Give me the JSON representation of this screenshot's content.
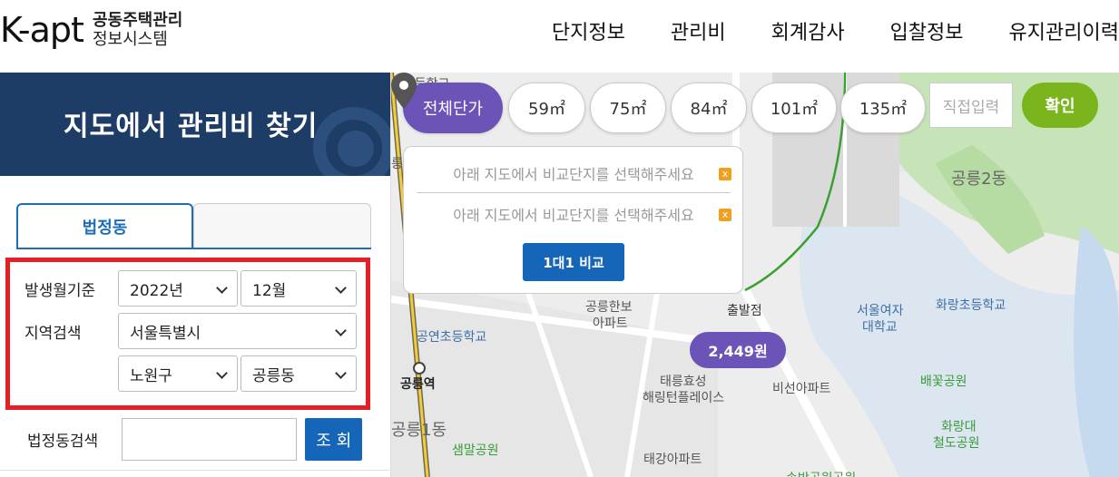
{
  "header": {
    "logo_text": "K-apt",
    "logo_sub_line1": "공동주택관리",
    "logo_sub_line2": "정보시스템",
    "nav": [
      "단지정보",
      "관리비",
      "회계감사",
      "입찰정보",
      "유지관리이력"
    ]
  },
  "sidebar": {
    "title": "지도에서 관리비 찾기",
    "tabs": {
      "active": "법정동",
      "inactive": ""
    },
    "filters": {
      "date_label": "발생월기준",
      "year": "2022년",
      "month": "12월",
      "region_label": "지역검색",
      "city": "서울특별시",
      "district": "노원구",
      "dong": "공릉동"
    },
    "legal_search_label": "법정동검색",
    "legal_search_button": "조 회"
  },
  "map": {
    "area_pills": [
      "전체단가",
      "59㎡",
      "75㎡",
      "84㎡",
      "101㎡",
      "135㎡"
    ],
    "direct_input_placeholder": "직접입력",
    "confirm_button": "확인",
    "compare": {
      "slot1": "아래 지도에서 비교단지를 선택해주세요",
      "slot2": "아래 지도에서 비교단지를 선택해주세요",
      "close": "x",
      "button": "1대1 비교"
    },
    "price_bubble": "2,449원",
    "labels": {
      "top_school": "촌초등학교",
      "left_edge": "릉",
      "gongneung2": "공릉2동",
      "gongneung_hanbo1": "공릉한보",
      "gongneung_hanbo2": "아파트",
      "chulbaljeom": "출발점",
      "seoul_womens1": "서울여자",
      "seoul_womens2": "대학교",
      "hwarang_elem": "화랑초등학교",
      "gongyeon_elem": "공연초등학교",
      "gongneung_station": "공릉역",
      "taereung1": "태릉효성",
      "taereung2": "해링턴플레이스",
      "biseon": "비선아파트",
      "baekkot": "배꽃공원",
      "gongneung1": "공릉1동",
      "hwarangdae1": "화랑대",
      "hwarangdae2": "철도공원",
      "saemmal": "샘말공원",
      "taegang": "태강아파트",
      "bottom_park": "송박공원공원"
    }
  },
  "colors": {
    "navy": "#1e3d66",
    "blue": "#1565b8",
    "purple": "#6b53b8",
    "green": "#7ab51d",
    "red_highlight": "#e31e24"
  }
}
